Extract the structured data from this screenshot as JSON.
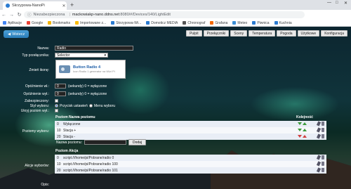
{
  "browser": {
    "tab_title": "Skrzypowa-NanoPi",
    "address_warning": "Niezabezpieczona",
    "url_host": "mackowiakp-nano.ddns.net",
    "url_rest": ":8080/#/Devices/140/LightEdit"
  },
  "bookmarks": [
    {
      "label": "Aplikacje",
      "color": "#4285f4"
    },
    {
      "label": "Google",
      "color": "#ea4335"
    },
    {
      "label": "Bookmarks",
      "color": "#f4b400"
    },
    {
      "label": "Importowane z...",
      "color": "#fbbc05"
    },
    {
      "label": "Skrzypowa-Wi...",
      "color": "#2b7bd1"
    },
    {
      "label": "Domoticz MEDIA",
      "color": "#2b7bd1"
    },
    {
      "label": "Chronograf",
      "color": "#555555"
    },
    {
      "label": "Grafana",
      "color": "#f46800"
    },
    {
      "label": "Meteo",
      "color": "#3b8ed6"
    },
    {
      "label": "Piwnica",
      "color": "#2b7bd1"
    },
    {
      "label": "Kuchnia",
      "color": "#2b7bd1"
    }
  ],
  "nav": {
    "back_label": "Wstecz",
    "menu": [
      "Pulpit",
      "Przełączniki",
      "Sceny",
      "Temperatura",
      "Pogoda",
      "Użytkowe",
      "Konfiguracja"
    ]
  },
  "form": {
    "name_label": "Nazwa:",
    "name_value": "Radio",
    "switch_type_label": "Typ przełącznika:",
    "switch_type_value": "Selector",
    "icon_label": "Zmień ikonę:",
    "icon_title": "Button Radio 4",
    "icon_subtitle": "Icon Radio 1 generator na Wizi Pi",
    "on_delay_label": "Opóźnienie wł.:",
    "on_delay_value": "0",
    "on_delay_hint": "(sekundy) 0 = wyłączone",
    "off_delay_label": "Opóźnienie wył.:",
    "off_delay_value": "0",
    "off_delay_hint": "(sekundy) 0 = wyłączone",
    "protected_label": "Zabezpieczony:",
    "style_label": "Styl wyboru:",
    "style_opt1": "Przycisk ustawień",
    "style_opt2": "Menu wyboru",
    "hide_off_label": "Ukryj poziom wył.:",
    "levels_label": "Poziomy wyboru:",
    "col_level": "Poziom",
    "col_name": "Nazwa poziomu",
    "col_order": "Kolejność",
    "levels": [
      {
        "level": "0",
        "name": "Wyłączone"
      },
      {
        "level": "10",
        "name": "Stacja +"
      },
      {
        "level": "20",
        "name": "Stacja -"
      }
    ],
    "new_level_label": "Nazwa poziomu:",
    "add_button": "Dodaj",
    "actions_label": "Akcje wyborów:",
    "col_action": "Poziom  Akcja",
    "actions": [
      {
        "level": "0",
        "action": "script:///home/pi/Pobrane/radio 0"
      },
      {
        "level": "10",
        "action": "script:///home/pi/Pobrane/radio 100"
      },
      {
        "level": "20",
        "action": "script:///home/pi/Pobrane/radio 101"
      }
    ],
    "description_label": "Opis:"
  }
}
